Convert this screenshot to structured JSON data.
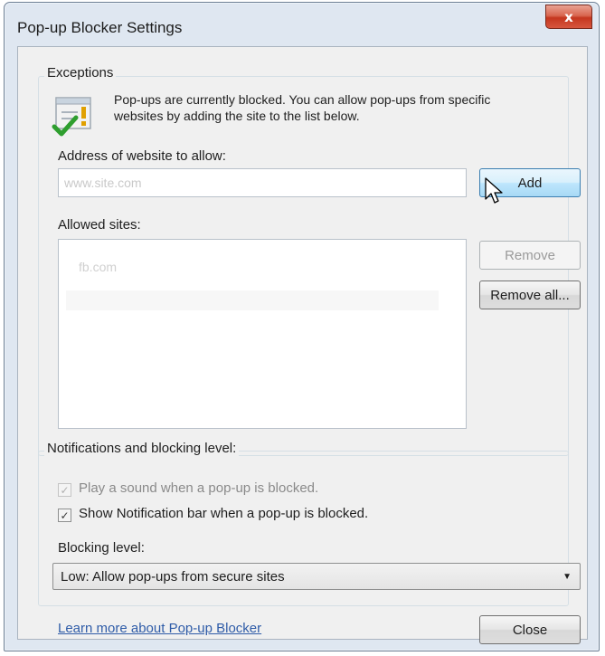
{
  "window": {
    "title": "Pop-up Blocker Settings",
    "close_glyph": "x"
  },
  "exceptions": {
    "legend": "Exceptions",
    "info_line1": "Pop-ups are currently blocked.  You can allow pop-ups from specific",
    "info_line2": "websites by adding the site to the list below.",
    "info_icon": "warning-shield-icon",
    "address_label": "Address of website to allow:",
    "address_value": "www.site.com",
    "add_label": "Add",
    "allowed_label": "Allowed sites:",
    "allowed_sites": [
      "fb.com"
    ],
    "remove_label": "Remove",
    "remove_all_label": "Remove all..."
  },
  "notifications": {
    "legend": "Notifications and blocking level:",
    "play_sound_label": "Play a sound when a pop-up is blocked.",
    "play_sound_checked": true,
    "show_bar_label": "Show Notification bar when a pop-up is blocked.",
    "show_bar_checked": true,
    "blocking_level_label": "Blocking level:",
    "blocking_level_value": "Low: Allow pop-ups from secure sites"
  },
  "footer": {
    "learn_more": "Learn more about Pop-up Blocker",
    "close_label": "Close"
  },
  "colors": {
    "accent": "#3c7fb1",
    "link": "#2f5ca8",
    "close_red": "#c5371f"
  }
}
